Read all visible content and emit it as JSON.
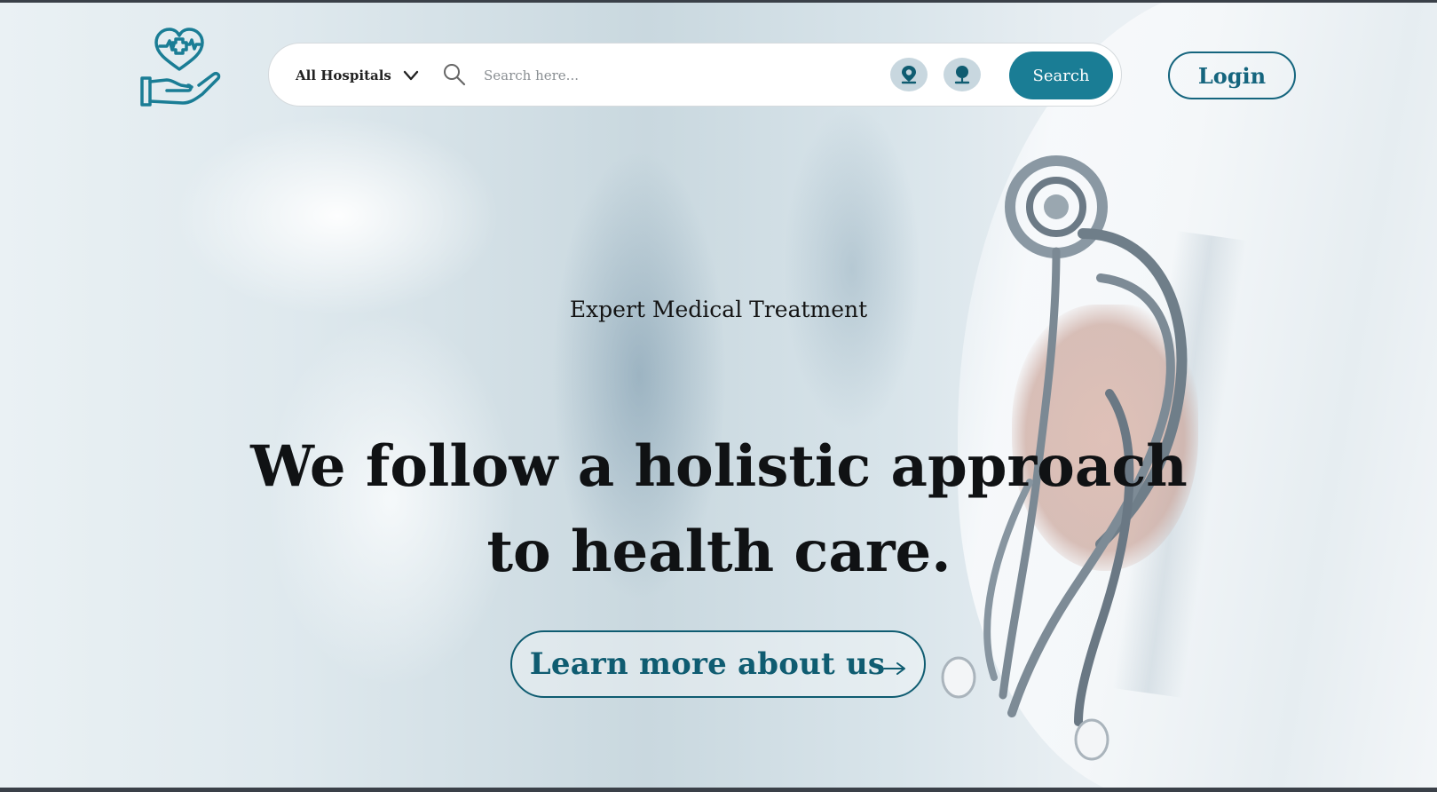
{
  "header": {
    "hospital_select": {
      "selected": "All Hospitals"
    },
    "search": {
      "placeholder": "Search here...",
      "value": "",
      "button_label": "Search"
    },
    "login_label": "Login"
  },
  "hero": {
    "eyebrow": "Expert Medical Treatment",
    "headline_line1": "We follow a holistic approach",
    "headline_line2": "to health care.",
    "cta_label": "Learn more about us"
  },
  "colors": {
    "brand_teal": "#1a7d95",
    "brand_dark_teal": "#15657e",
    "icon_bg": "#c8d7df"
  },
  "icons": {
    "logo": "heart-in-hand-logo",
    "dropdown": "chevron-down-icon",
    "search": "search-icon",
    "location": "location-pin-icon",
    "doctor": "doctor-icon",
    "cta": "arrow-right-icon"
  }
}
